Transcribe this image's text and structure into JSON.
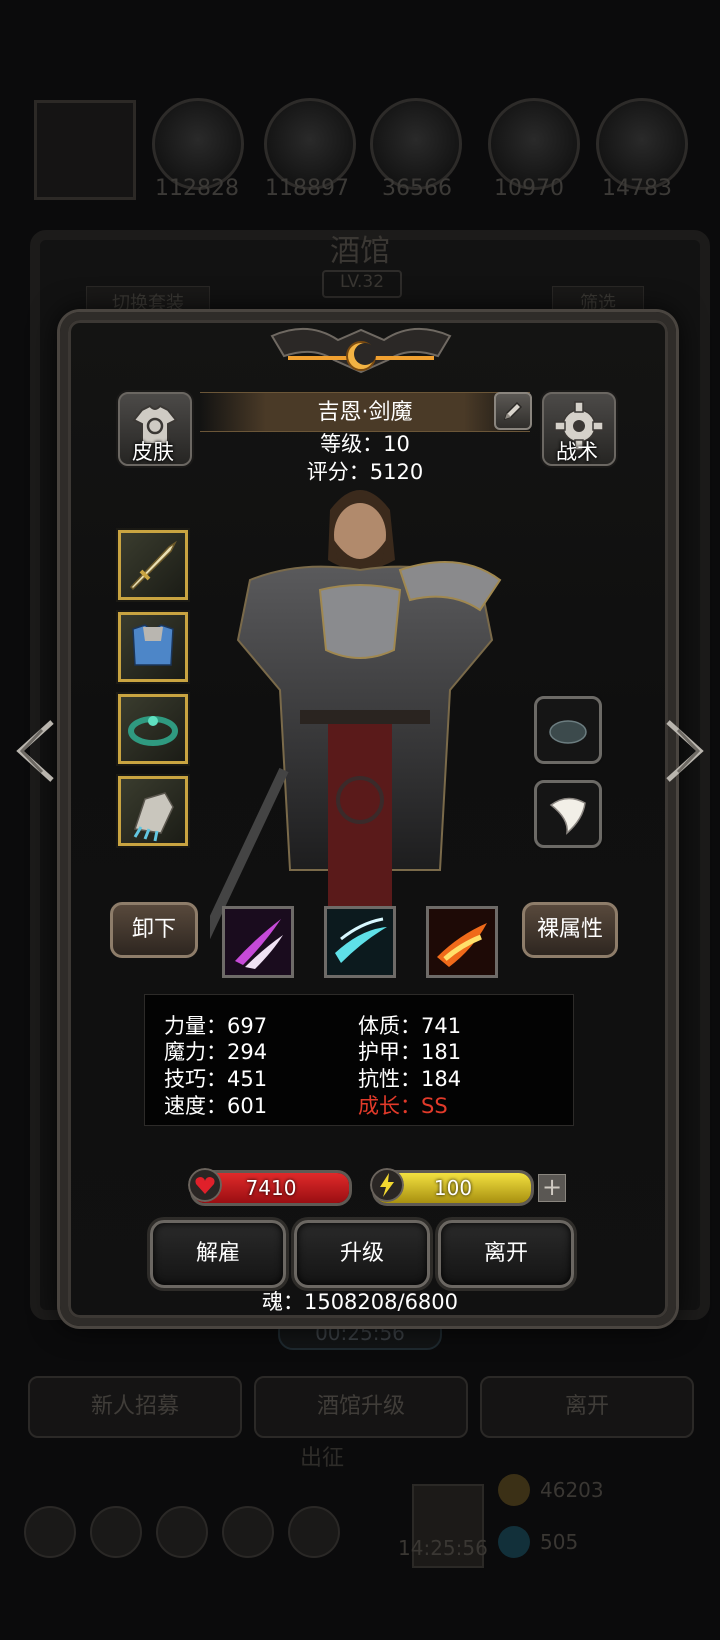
{
  "background": {
    "resources": [
      "112828",
      "118897",
      "36566",
      "10970",
      "14783"
    ],
    "title": "酒馆",
    "level": "LV.32",
    "tab_left": "切换套装",
    "tab_right": "筛选",
    "timer": "00:25:56",
    "buttons": [
      "新人招募",
      "酒馆升级",
      "离开"
    ],
    "expedition": "出征",
    "clock": "14:25:56",
    "gold": "46203",
    "gems": "505"
  },
  "hero": {
    "name": "吉恩·剑魔",
    "level_line": "等级：10",
    "score_line": "评分：5120"
  },
  "buttons": {
    "skin": "皮肤",
    "tactics": "战术",
    "unequip": "卸下",
    "base_attr": "裸属性",
    "dismiss": "解雇",
    "upgrade": "升级",
    "leave": "离开"
  },
  "stats": {
    "strength": "力量：697",
    "constitution": "体质：741",
    "magic": "魔力：294",
    "armor": "护甲：181",
    "skill": "技巧：451",
    "resistance": "抗性：184",
    "speed": "速度：601",
    "growth": "成长：SS"
  },
  "bars": {
    "hp": "7410",
    "energy": "100",
    "plus": "+"
  },
  "soul": "魂：1508208/6800",
  "colors": {
    "growth": "#e23a2a",
    "hp": "#c4161c",
    "energy": "#d6c21a",
    "gold_border": "#c9a441"
  }
}
